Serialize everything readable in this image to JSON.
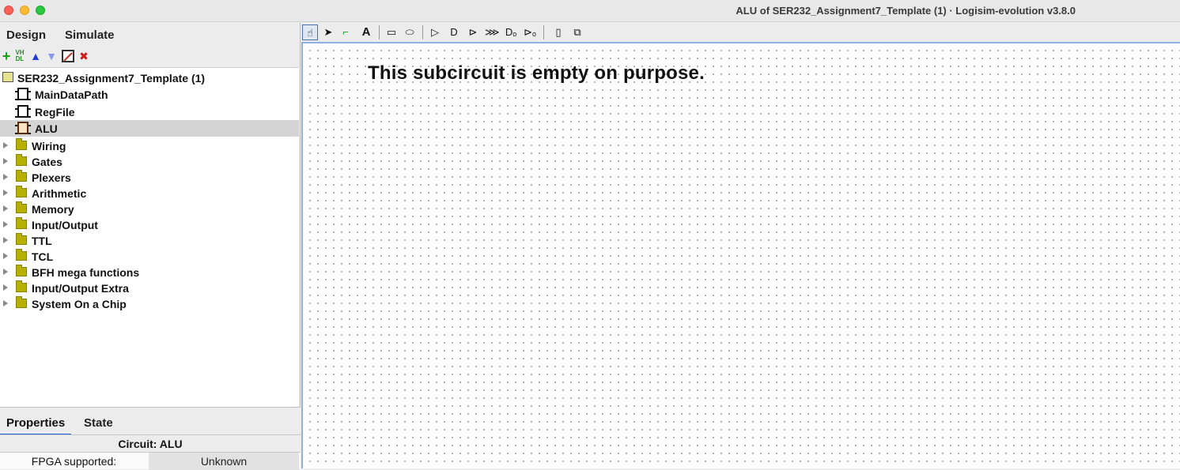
{
  "window": {
    "title": "ALU of SER232_Assignment7_Template (1) · Logisim-evolution v3.8.0"
  },
  "explorer": {
    "tabs": [
      "Design",
      "Simulate"
    ],
    "toolbar": [
      {
        "icon": "add-circuit-icon",
        "color": "#1a9e1a"
      },
      {
        "icon": "add-vhdl-icon",
        "color": "#2a8a2a"
      },
      {
        "icon": "move-up-icon",
        "color": "#1a3fd6"
      },
      {
        "icon": "move-down-icon",
        "color": "#8a9ae6"
      },
      {
        "icon": "edit-appearance-icon",
        "color": "#333333"
      },
      {
        "icon": "delete-icon",
        "color": "#d11a1a"
      }
    ],
    "project": "SER232_Assignment7_Template (1)",
    "circuits": [
      "MainDataPath",
      "RegFile",
      "ALU"
    ],
    "selected_circuit": "ALU",
    "libraries": [
      "Wiring",
      "Gates",
      "Plexers",
      "Arithmetic",
      "Memory",
      "Input/Output",
      "TTL",
      "TCL",
      "BFH mega functions",
      "Input/Output Extra",
      "System On a Chip"
    ]
  },
  "properties": {
    "tabs": [
      "Properties",
      "State"
    ],
    "active_tab": "Properties",
    "header": "Circuit: ALU",
    "rows": [
      {
        "name": "FPGA supported:",
        "value": "Unknown"
      }
    ]
  },
  "canvas_toolbar": {
    "tools": [
      "poke-tool-icon",
      "select-tool-icon",
      "wiring-tool-icon",
      "text-tool-icon",
      "input-pin-icon",
      "output-pin-icon",
      "buffer-gate-icon",
      "and-gate-icon",
      "or-gate-icon",
      "xor-gate-icon",
      "nand-gate-icon",
      "nor-gate-icon",
      "chip-tool-icon",
      "subcircuit-tool-icon"
    ],
    "text_tool_glyph": "A"
  },
  "canvas": {
    "text": "This subcircuit is empty on purpose."
  }
}
